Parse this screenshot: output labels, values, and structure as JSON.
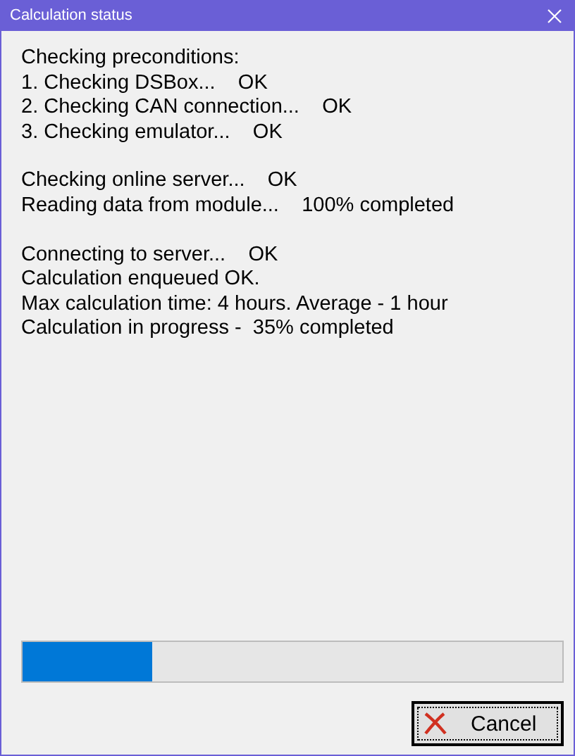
{
  "window": {
    "title": "Calculation status"
  },
  "groups": [
    [
      "Checking preconditions:",
      "1. Checking DSBox...    OK",
      "2. Checking CAN connection...    OK",
      "3. Checking emulator...    OK"
    ],
    [
      "Checking online server...    OK",
      "Reading data from module...    100% completed"
    ],
    [
      "Connecting to server...    OK",
      "Calculation enqueued OK.",
      "Max calculation time: 4 hours. Average - 1 hour",
      "Calculation in progress -  35% completed"
    ]
  ],
  "progress": {
    "level": 0.24
  },
  "cancel_button": {
    "label": "Cancel"
  }
}
